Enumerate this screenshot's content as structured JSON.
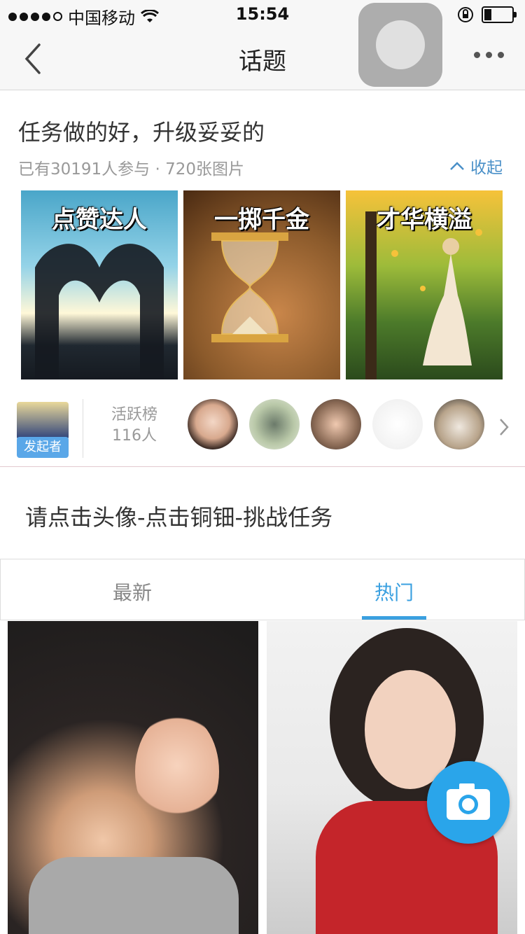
{
  "status_bar": {
    "carrier": "中国移动",
    "time": "15:54"
  },
  "nav": {
    "title": "话题"
  },
  "topic": {
    "title": "任务做的好，升级妥妥的",
    "meta": "已有30191人参与 · 720张图片",
    "collapse_label": "收起"
  },
  "cards": [
    {
      "label": "点赞达人"
    },
    {
      "label": "一掷千金"
    },
    {
      "label": "才华横溢"
    }
  ],
  "active_row": {
    "starter_badge": "发起者",
    "rank_title": "活跃榜",
    "rank_count": "116人"
  },
  "instruction": "请点击头像-点击铜钿-挑战任务",
  "tabs": {
    "newest": "最新",
    "hot": "热门",
    "selected": "热门"
  },
  "colors": {
    "accent": "#3aa0e0",
    "fab": "#2aa5ea",
    "badge": "#5aa7e8"
  }
}
